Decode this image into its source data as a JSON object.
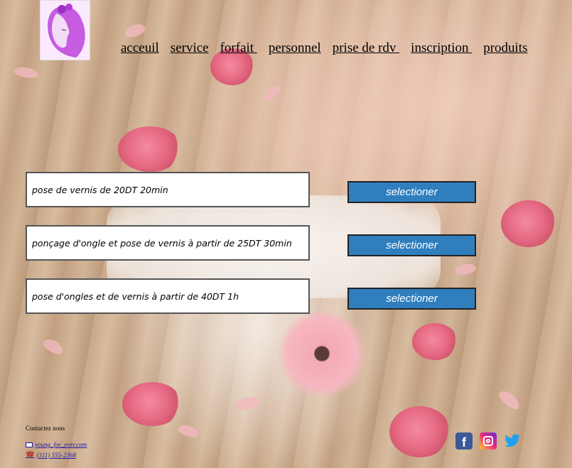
{
  "nav": {
    "items": [
      {
        "label": "acceuil",
        "active": false
      },
      {
        "label": "service",
        "active": false
      },
      {
        "label": "forfait ",
        "active": false
      },
      {
        "label": "personnel",
        "active": false
      },
      {
        "label": "prise de rdv ",
        "active": false
      },
      {
        "label": "inscription ",
        "active": false
      },
      {
        "label": "produits",
        "active": false
      }
    ]
  },
  "services": [
    {
      "description": "pose de vernis de 20DT 20min",
      "button": "selectioner"
    },
    {
      "description": "ponçage d'ongle et pose de vernis à partir de 25DT 30min",
      "button": "selectioner"
    },
    {
      "description": "pose d'ongles et de vernis à partir de 40DT 1h",
      "button": "selectioner"
    }
  ],
  "footer": {
    "contact_title": "Contactez nous",
    "email": "young_for_ever.com",
    "phone": "(311) 555-2368",
    "social": [
      "facebook-icon",
      "instagram-icon",
      "twitter-icon"
    ]
  },
  "colors": {
    "button": "#2f7fbf",
    "facebook": "#3b5998",
    "twitter": "#1da1f2"
  }
}
